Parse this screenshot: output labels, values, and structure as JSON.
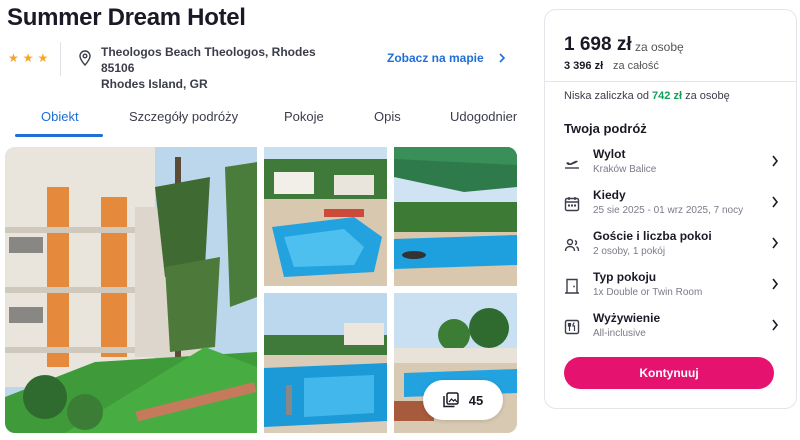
{
  "hotel": {
    "name": "Summer Dream Hotel",
    "stars": 3,
    "address_line1": "Theologos Beach Theologos, Rhodes 85106",
    "address_line2": "Rhodes Island, GR",
    "map_link": "Zobacz na mapie"
  },
  "tabs": [
    {
      "label": "Obiekt",
      "active": true
    },
    {
      "label": "Szczegóły podróży",
      "active": false
    },
    {
      "label": "Pokoje",
      "active": false
    },
    {
      "label": "Opis",
      "active": false
    },
    {
      "label": "Udogodnienia",
      "active": false
    }
  ],
  "gallery": {
    "photo_count": "45"
  },
  "booking": {
    "price": "1 698 zł",
    "price_suffix": "za osobę",
    "total": "3 396 zł",
    "total_suffix": "za całość",
    "deposit_prefix": "Niska zaliczka od",
    "deposit_amount": "742 zł",
    "deposit_suffix": "za osobę",
    "trip_title": "Twoja podróż",
    "rows": [
      {
        "icon": "plane-icon",
        "label": "Wylot",
        "value": "Kraków Balice"
      },
      {
        "icon": "calendar-icon",
        "label": "Kiedy",
        "value": "25 sie 2025 - 01 wrz 2025, 7 nocy"
      },
      {
        "icon": "guests-icon",
        "label": "Goście i liczba pokoi",
        "value": "2 osoby, 1 pokój"
      },
      {
        "icon": "door-icon",
        "label": "Typ pokoju",
        "value": "1x Double or Twin Room"
      },
      {
        "icon": "cutlery-icon",
        "label": "Wyżywienie",
        "value": "All-inclusive"
      }
    ],
    "cta": "Kontynuuj"
  },
  "colors": {
    "accent_blue": "#1f6fd6",
    "cta_pink": "#e5136f",
    "deposit_green": "#12a05c",
    "star_gold": "#f5a623"
  }
}
